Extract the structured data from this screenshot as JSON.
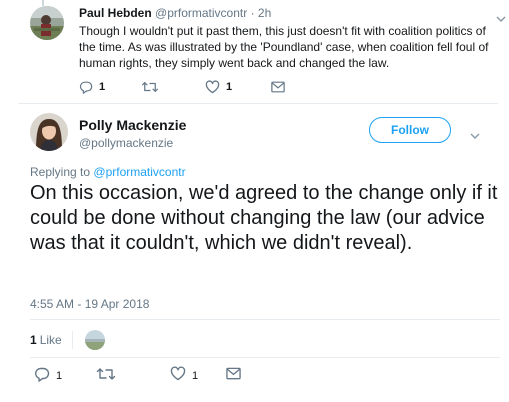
{
  "parent_tweet": {
    "author_name": "Paul Hebden",
    "author_handle": "@prformativcontr",
    "separator": "·",
    "time": "2h",
    "text": "Though I wouldn't put it past them, this just doesn't fit with coalition politics of the time. As was illustrated by the 'Poundland' case, when coalition fell foul of human rights, they simply went back and changed the law.",
    "actions": {
      "reply_count": "1",
      "retweet_count": "",
      "like_count": "1"
    }
  },
  "main_tweet": {
    "author_name": "Polly Mackenzie",
    "author_handle": "@pollymackenzie",
    "follow_label": "Follow",
    "replying_prefix": "Replying to",
    "replying_to": "@prformativcontr",
    "text": "On this occasion, we'd agreed to the change only if it could be done without changing the law (our advice was that it couldn't, which we didn't reveal).",
    "timestamp": "4:55 AM - 19 Apr 2018",
    "likes_count": "1",
    "likes_label": "Like",
    "actions": {
      "reply_count": "1",
      "retweet_count": "",
      "like_count": "1"
    }
  },
  "colors": {
    "accent": "#1da1f2",
    "text": "#14171a",
    "muted": "#657786",
    "divider": "#e6ecf0",
    "icon": "#657786"
  },
  "icons": [
    "reply-icon",
    "retweet-icon",
    "heart-icon",
    "envelope-icon",
    "chevron-down-icon"
  ]
}
